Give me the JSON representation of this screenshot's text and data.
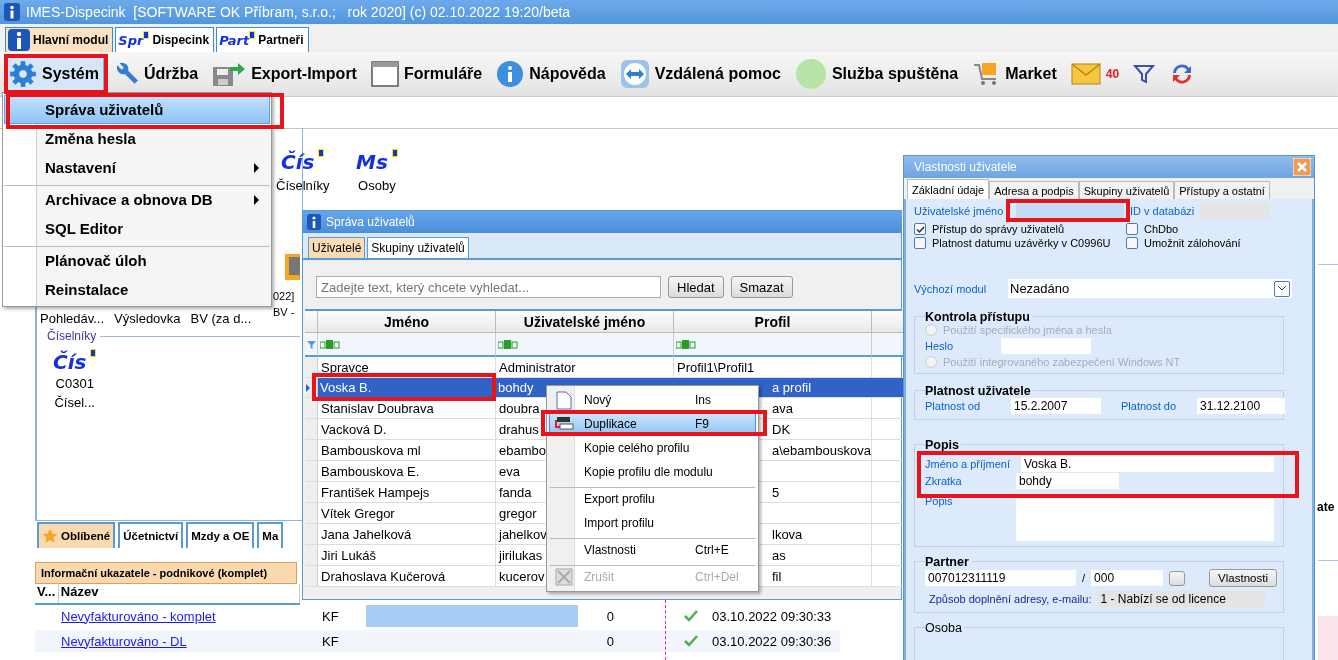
{
  "window": {
    "title": "IMES-Dispecink  [SOFTWARE OK Příbram, s.r.o.;   rok 2020] (c) 02.10.2022 19:20/beta"
  },
  "module_tabs": [
    {
      "label": "Hlavní modul",
      "kind": "info",
      "selected": true
    },
    {
      "label": "Dispecink",
      "kind": "badge",
      "badge": "Spr",
      "selected": false
    },
    {
      "label": "Partneři",
      "kind": "badge",
      "badge": "Part",
      "selected": false
    }
  ],
  "toolbar": [
    {
      "label": "Systém",
      "kind": "gear",
      "selected": true
    },
    {
      "label": "Údržba",
      "kind": "wrench",
      "selected": false
    },
    {
      "label": "Export-Import",
      "kind": "export",
      "selected": false
    },
    {
      "label": "Formuláře",
      "kind": "form",
      "selected": false
    },
    {
      "label": "Nápověda",
      "kind": "help",
      "selected": false
    },
    {
      "label": "Vzdálená pomoc",
      "kind": "remote",
      "selected": false
    },
    {
      "label": "Služba spuštěna",
      "kind": "status",
      "selected": false
    },
    {
      "label": "Market",
      "kind": "market",
      "selected": false
    },
    {
      "label": "40",
      "kind": "mail",
      "selected": false
    },
    {
      "kind": "filter",
      "selected": false
    },
    {
      "kind": "refresh",
      "selected": false
    }
  ],
  "system_menu": [
    {
      "label": "Správa uživatelů",
      "selected": true,
      "submenu": false,
      "separator_before": false
    },
    {
      "label": "Změna hesla",
      "selected": false,
      "submenu": false,
      "separator_before": false
    },
    {
      "label": "Nastavení",
      "selected": false,
      "submenu": true,
      "separator_before": false
    },
    {
      "label": "Archivace a obnova DB",
      "selected": false,
      "submenu": true,
      "separator_before": true
    },
    {
      "label": "SQL Editor",
      "selected": false,
      "submenu": false,
      "separator_before": false
    },
    {
      "label": "Plánovač úloh",
      "selected": false,
      "submenu": false,
      "separator_before": true
    },
    {
      "label": "Reinstalace",
      "selected": false,
      "submenu": false,
      "separator_before": false
    }
  ],
  "desktop": {
    "shortcuts": [
      {
        "badge": "Čís",
        "label": "Číselníky"
      },
      {
        "badge": "Ms",
        "label": "Osoby"
      }
    ],
    "side_labels": [
      "022]",
      "BV -"
    ],
    "tiles": [
      "Pohledáv...",
      "Výsledovka",
      "BV (za d..."
    ],
    "group": {
      "title": "Číselníky",
      "items": [
        {
          "badge": "Čís",
          "lines": [
            "C0301",
            "Čísel..."
          ]
        }
      ]
    },
    "bottom_tabs": [
      {
        "label": "Oblíbené",
        "kind": "star",
        "selected": true
      },
      {
        "label": "Účetnictví",
        "kind": "plain",
        "selected": false
      },
      {
        "label": "Mzdy a OE",
        "kind": "plain",
        "selected": false
      },
      {
        "label": "Ma",
        "kind": "plain",
        "selected": false
      }
    ],
    "info_tab": "Informační ukazatele - podnikové (komplet)",
    "grid": {
      "columns": [
        "V...",
        "Název"
      ],
      "rows": [
        {
          "name": "Nevyfakturováno - komplet",
          "type": "KF",
          "highlighted": true,
          "count": "0",
          "ok": true,
          "date": "03.10.2022 09:30:33"
        },
        {
          "name": "Nevyfakturováno - DL",
          "type": "KF",
          "highlighted": false,
          "count": "0",
          "ok": true,
          "date": "03.10.2022 09:30:36"
        }
      ]
    },
    "right_edge_text": "ate"
  },
  "user_window": {
    "title": "Správa uživatelů",
    "tabs": [
      {
        "label": "Uživatelé",
        "selected": true
      },
      {
        "label": "Skupiny uživatelů",
        "selected": false
      }
    ],
    "search": {
      "placeholder": "Zadejte text, který chcete vyhledat..."
    },
    "buttons": [
      "Hledat",
      "Smazat"
    ],
    "columns": [
      "Jméno",
      "Uživatelské jméno",
      "Profil"
    ],
    "rows": [
      {
        "name": "Spravce",
        "login": "Administrator",
        "profile": "Profil1\\Profil1",
        "selected": false
      },
      {
        "name": "Voska B.",
        "login": "bohdy",
        "profile": "a profil",
        "selected": true
      },
      {
        "name": "Stanislav Doubrava",
        "login": "doubra",
        "profile": "ava",
        "selected": false
      },
      {
        "name": "Vacková D.",
        "login": "drahus",
        "profile": "DK",
        "selected": false
      },
      {
        "name": "Bambouskova ml",
        "login": "ebambo",
        "profile": "a\\ebambouskova",
        "selected": false
      },
      {
        "name": "Bambouskova E.",
        "login": "eva",
        "selected": false
      },
      {
        "name": "František Hampejs",
        "login": "fanda",
        "profile": "5",
        "selected": false
      },
      {
        "name": "Vítek Gregor",
        "login": "gregor",
        "selected": false
      },
      {
        "name": "Jana Jahelková",
        "login": "jahelkov",
        "profile": "lkova",
        "selected": false
      },
      {
        "name": "Jiri Lukáš",
        "login": "jirilukas",
        "profile": "as",
        "selected": false
      },
      {
        "name": "Drahoslava Kučerová",
        "login": "kucerov",
        "profile": "fil",
        "selected": false
      }
    ]
  },
  "context_menu": [
    {
      "label": "Nový",
      "shortcut": "Ins",
      "kind": "new",
      "selected": false,
      "disabled": false,
      "separator_before": false
    },
    {
      "label": "Duplikace",
      "shortcut": "F9",
      "kind": "duplicate",
      "selected": true,
      "disabled": false,
      "separator_before": false
    },
    {
      "label": "Kopie celého profilu",
      "kind": "plain",
      "selected": false,
      "disabled": false,
      "separator_before": false
    },
    {
      "label": "Kopie profilu dle modulu",
      "kind": "plain",
      "selected": false,
      "disabled": false,
      "separator_before": false
    },
    {
      "label": "Export profilu",
      "kind": "plain",
      "selected": false,
      "disabled": false,
      "separator_before": true
    },
    {
      "label": "Import profilu",
      "kind": "plain",
      "selected": false,
      "disabled": false,
      "separator_before": false
    },
    {
      "label": "Vlastnosti",
      "shortcut": "Ctrl+E",
      "kind": "plain",
      "selected": false,
      "disabled": false,
      "separator_before": true
    },
    {
      "label": "Zrušit",
      "shortcut": "Ctrl+Del",
      "kind": "delete",
      "selected": false,
      "disabled": true,
      "separator_before": true
    }
  ],
  "user_dialog": {
    "title": "Vlastnosti uživatele",
    "tabs": [
      {
        "label": "Základní údaje",
        "selected": true
      },
      {
        "label": "Adresa a podpis",
        "selected": false
      },
      {
        "label": "Skupiny uživatelů",
        "selected": false
      },
      {
        "label": "Přístupy a ostatní",
        "selected": false
      }
    ],
    "login_label": "Uživatelské jméno",
    "id_label": "ID v databázi",
    "checks": [
      {
        "label": "Přístup do správy uživatelů",
        "checked": true
      },
      {
        "label": "Platnost datumu uzávěrky v C0996U",
        "checked": false
      },
      {
        "label": "ChDbo",
        "checked": false
      },
      {
        "label": "Umožnit zálohování",
        "checked": false
      }
    ],
    "module_label": "Výchozí modul",
    "module_value": "Nezadáno",
    "access": {
      "title": "Kontrola přístupu",
      "disabled": true,
      "password_label": "Heslo",
      "options": [
        {
          "label": "Použití specifického jména a hesla",
          "selected": false
        },
        {
          "label": "Použití integrovaného zabezpečení Windows NT",
          "selected": false
        }
      ]
    },
    "validity": {
      "title": "Platnost uživatele",
      "from_label": "Platnost od",
      "from": "15.2.2007",
      "to_label": "Platnost do",
      "to": "31.12.2100"
    },
    "description": {
      "title": "Popis",
      "name_label": "Jméno a příjmení",
      "name": "Voska B.",
      "short_label": "Zkratka",
      "short": "bohdy",
      "note_label": "Popis"
    },
    "partner": {
      "title": "Partner",
      "number": "007012311119",
      "separator": "/",
      "branch": "000",
      "button": "Vlastnosti",
      "mode_label": "Způsob doplnění adresy, e-mailu:",
      "mode": "1 - Nabízí se od licence"
    },
    "person": {
      "title": "Osoba"
    }
  }
}
